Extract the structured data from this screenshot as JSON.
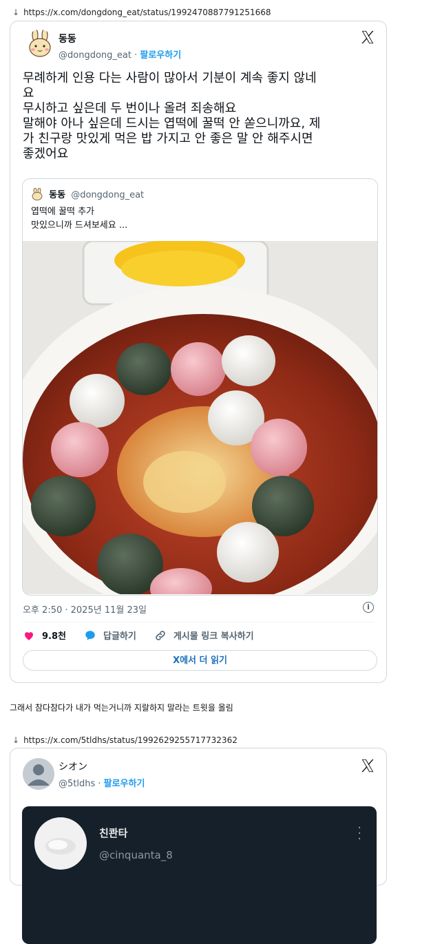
{
  "tweet1": {
    "url": "https://x.com/dongdong_eat/status/1992470887791251668",
    "name": "동동",
    "handle": "@dongdong_eat",
    "separator": "·",
    "follow": "팔로우하기",
    "text": "무례하게 인용 다는 사람이 많아서 기분이 계속 좋지 않네\n요\n무시하고 싶은데 두 번이나 올려 죄송해요\n말해야 아나 싶은데 드시는 엽떡에 꿀떡 안 쏟으니까요, 제\n가 친구랑 맛있게 먹은 밥 가지고 안 좋은 말 안 해주시면\n좋겠어요",
    "quote": {
      "name": "동동",
      "handle": "@dongdong_eat",
      "text": "엽떡에 꿀떡 추가\n맛있으니까 드셔보세요 ..."
    },
    "timestamp": "오후 2:50 · 2025년 11월 23일",
    "likes": "9.8천",
    "reply_label": "답글하기",
    "copy_link_label": "게시물 링크 복사하기",
    "read_more": "X에서 더 읽기"
  },
  "caption": "그래서 참다참다가 내가 먹는거니까 지랄하지 말라는 트윗을 올림",
  "tweet2": {
    "url": "https://x.com/5tldhs/status/1992629255717732362",
    "name": "シオン",
    "handle": "@5tldhs",
    "separator": "·",
    "follow": "팔로우하기",
    "embed_name": "친콴타",
    "embed_handle": "@cinquanta_8"
  },
  "icons": {
    "url_arrow": "down-arrow-icon",
    "x_logo": "x-logo-icon",
    "heart": "heart-icon",
    "reply": "speech-bubble-icon",
    "link": "link-icon",
    "info": "info-icon",
    "more": "more-vertical-icon"
  },
  "colors": {
    "link_blue": "#1d9bf0",
    "heart_pink": "#f91880",
    "embed_bg": "#15202b"
  }
}
